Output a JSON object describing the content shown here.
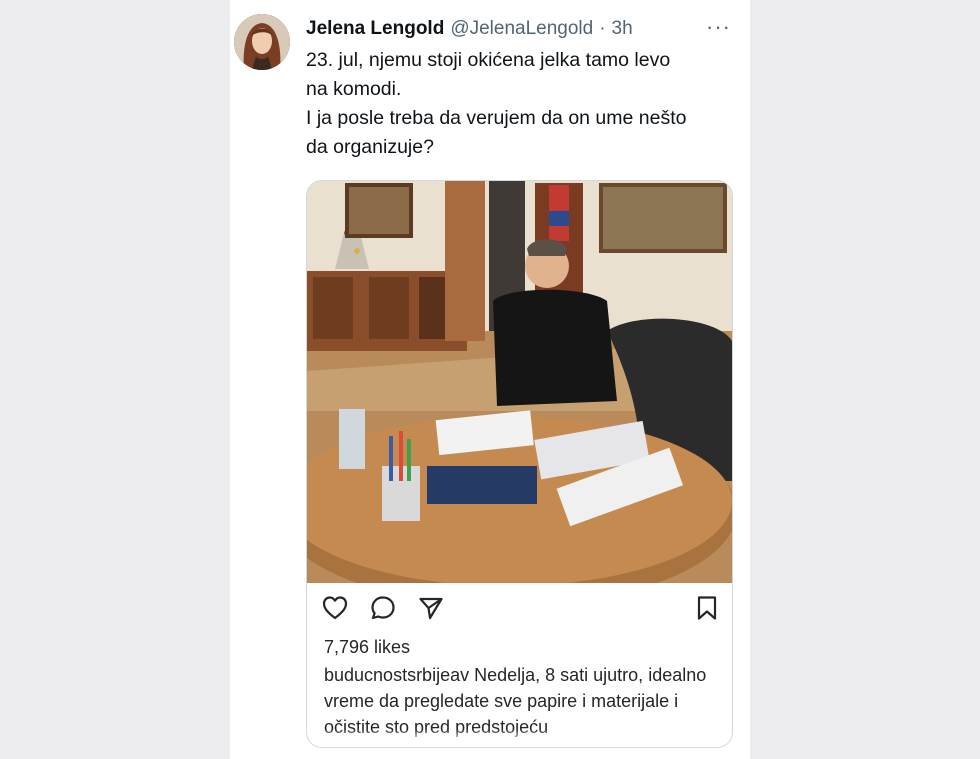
{
  "tweet": {
    "author_name": "Jelena Lengold",
    "author_handle": "@JelenaLengold",
    "separator": "·",
    "time": "3h",
    "more": "···",
    "text": "23. jul, njemu stoji okićena jelka tamo levo\nna komodi.\nI ja posle treba da verujem da on ume nešto\nda organizuje?"
  },
  "embedded_post": {
    "likes": "7,796 likes",
    "username": "buducnostsrbijeav",
    "caption": " Nedelja, 8 sati ujutro, idealno vreme da pregledate sve papire i materijale i očistite sto pred predstojeću"
  },
  "icons": {
    "like": "heart-icon",
    "comment": "comment-icon",
    "share": "send-icon",
    "save": "bookmark-icon"
  }
}
